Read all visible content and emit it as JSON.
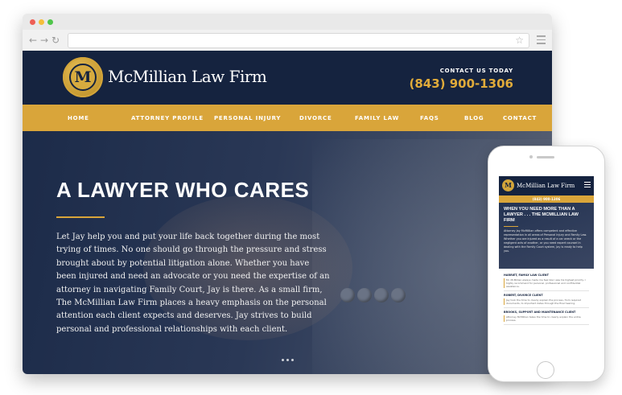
{
  "firm": {
    "name": "McMillian Law Firm",
    "monogram": "M",
    "contact_label": "CONTACT US TODAY",
    "phone": "(843) 900-1306"
  },
  "nav": {
    "items": [
      "HOME",
      "ATTORNEY PROFILE",
      "PERSONAL INJURY",
      "DIVORCE",
      "FAMILY LAW",
      "FAQS",
      "BLOG",
      "CONTACT"
    ]
  },
  "hero": {
    "heading": "A LAWYER WHO CARES",
    "body": "Let Jay help you and put your life back together during the most trying of times. No one should go through the pressure and stress brought about by potential litigation alone. Whether you have been injured and need an advocate or you need the expertise of an attorney in navigating Family Court, Jay is there. As a small firm, The McMillian Law Firm places a heavy emphasis on the personal attention each client expects and deserves. Jay strives to build personal and professional relationships with each client."
  },
  "mobile": {
    "phone": "(843) 900-1306",
    "heading": "WHEN YOU NEED MORE THAN A LAWYER . . . THE MCMILLIAN LAW FIRM",
    "body": "Attorney Jay McMillian offers competent and effective representation in all areas of Personal Injury and Family Law. Whether you are injured as a result of a car wreck or the negligent acts of another, or you need expert counsel in dealing with the Family Court system, Jay is ready to help you.",
    "testimonials": [
      {
        "name": "HARRIET, FAMILY LAW CLIENT",
        "quote": "Mr. McMillian always made me feel like I was his highest priority. I highly recommend for personal, professional and confidential assistance."
      },
      {
        "name": "ROBERT, DIVORCE CLIENT",
        "quote": "Jay took the time to clearly explain the process, from required documents, to important dates through the final hearing."
      },
      {
        "name": "BROOKS, SUPPORT AND MAINTENANCE CLIENT",
        "quote": "Attorney McMillian takes the time to clearly explain the entire process."
      }
    ]
  },
  "colors": {
    "navy": "#15233f",
    "gold": "#d9a53a"
  }
}
